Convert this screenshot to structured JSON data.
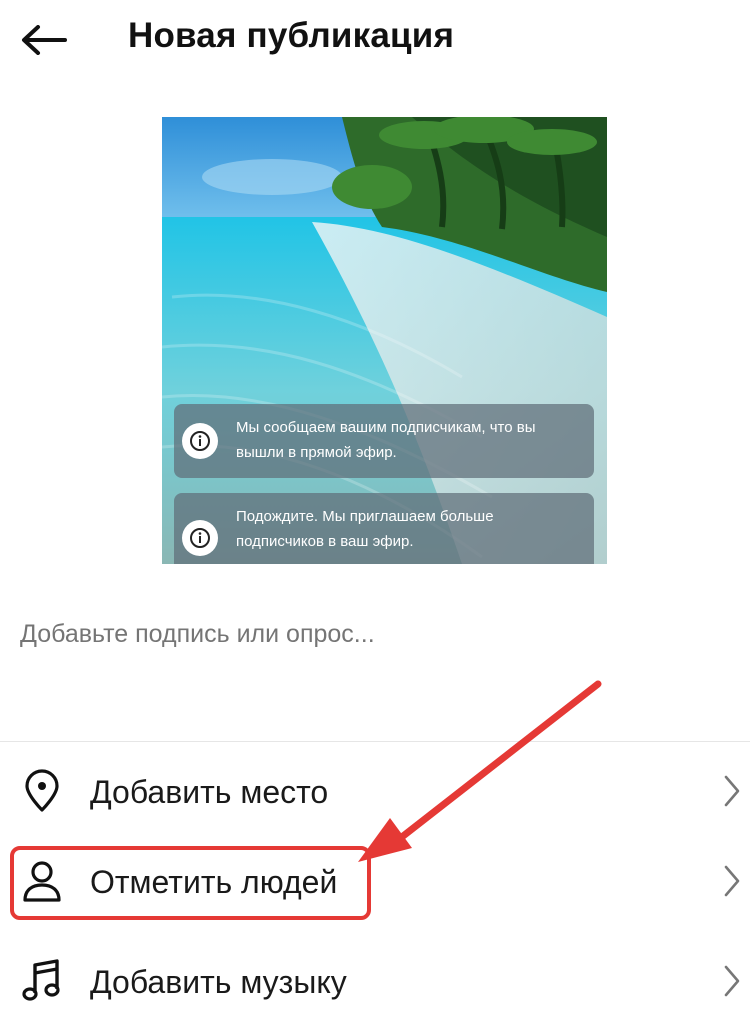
{
  "header": {
    "title": "Новая публикация",
    "back_icon": "arrow-left-icon"
  },
  "media": {
    "description_icon": "beach-photo",
    "notifications": [
      {
        "icon": "info-icon",
        "text": "Мы сообщаем вашим подписчикам, что вы вышли в прямой эфир."
      },
      {
        "icon": "info-icon",
        "text": "Подождите. Мы приглашаем больше подписчиков в ваш эфир."
      }
    ]
  },
  "caption": {
    "placeholder": "Добавьте подпись или опрос..."
  },
  "options": [
    {
      "icon": "location-pin-icon",
      "label": "Добавить место"
    },
    {
      "icon": "person-icon",
      "label": "Отметить людей",
      "highlighted": true
    },
    {
      "icon": "music-note-icon",
      "label": "Добавить музыку"
    }
  ],
  "colors": {
    "annotation": "#e53935",
    "placeholder_text": "#8e8e8e",
    "divider": "#e6e6e6"
  }
}
